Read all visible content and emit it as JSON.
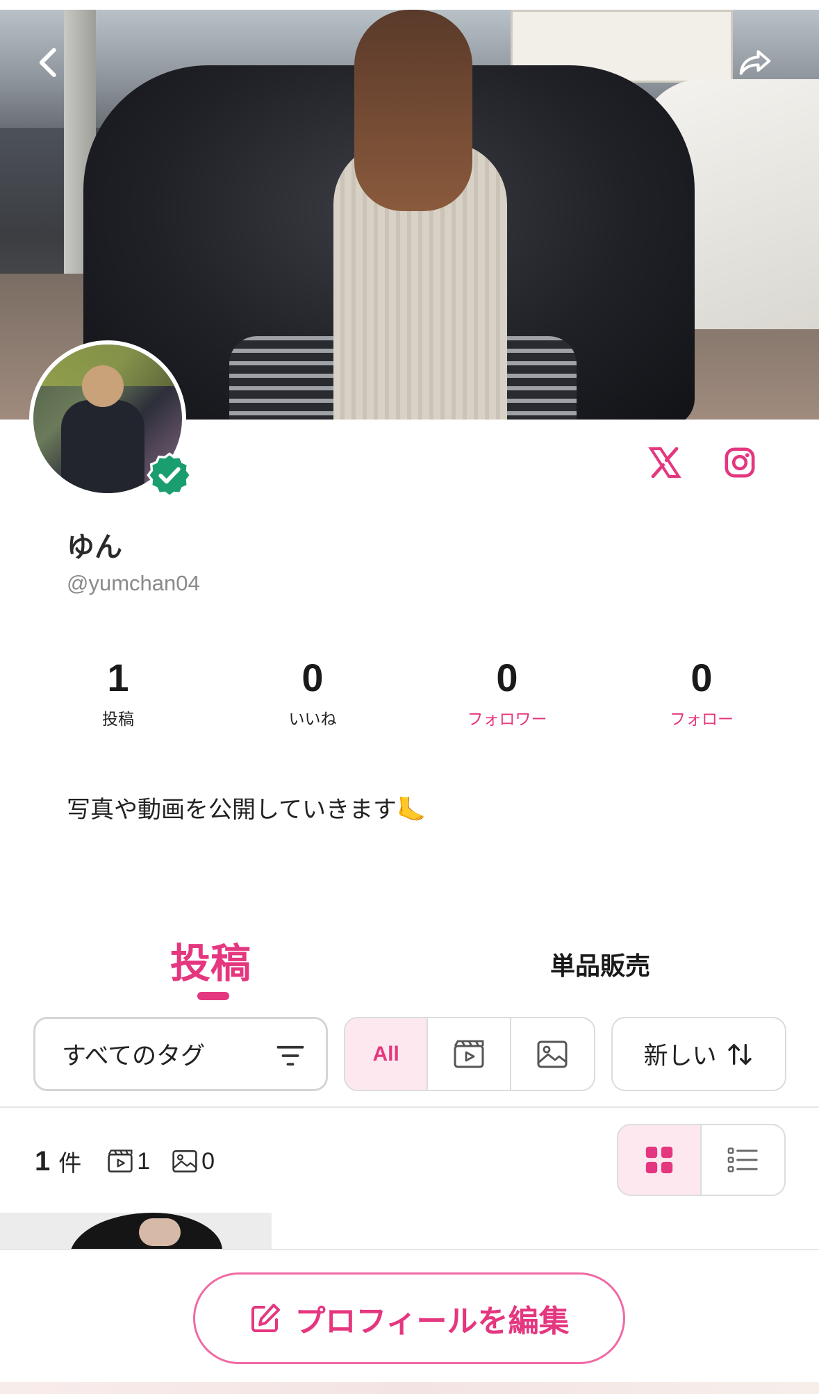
{
  "profile": {
    "name": "ゆん",
    "handle": "@yumchan04",
    "verified": true,
    "bio": "写真や動画を公開していきます🦶"
  },
  "stats": [
    {
      "value": "1",
      "label": "投稿"
    },
    {
      "value": "0",
      "label": "いいね"
    },
    {
      "value": "0",
      "label": "フォロワー"
    },
    {
      "value": "0",
      "label": "フォロー"
    }
  ],
  "tabs": {
    "posts": "投稿",
    "single_sale": "単品販売",
    "active": "posts"
  },
  "filters": {
    "tag_select": "すべてのタグ",
    "media_all": "All",
    "sort": "新しい"
  },
  "counts": {
    "total": "1",
    "unit": "件",
    "videos": "1",
    "images": "0"
  },
  "view_mode": "grid",
  "actions": {
    "edit_profile": "プロフィールを編集"
  },
  "colors": {
    "accent": "#e4377f",
    "accent_light": "#fde8f0",
    "verified": "#1b9e6f"
  },
  "icons": {
    "back": "chevron-left-icon",
    "share": "share-icon",
    "x": "x-logo-icon",
    "instagram": "instagram-icon"
  }
}
